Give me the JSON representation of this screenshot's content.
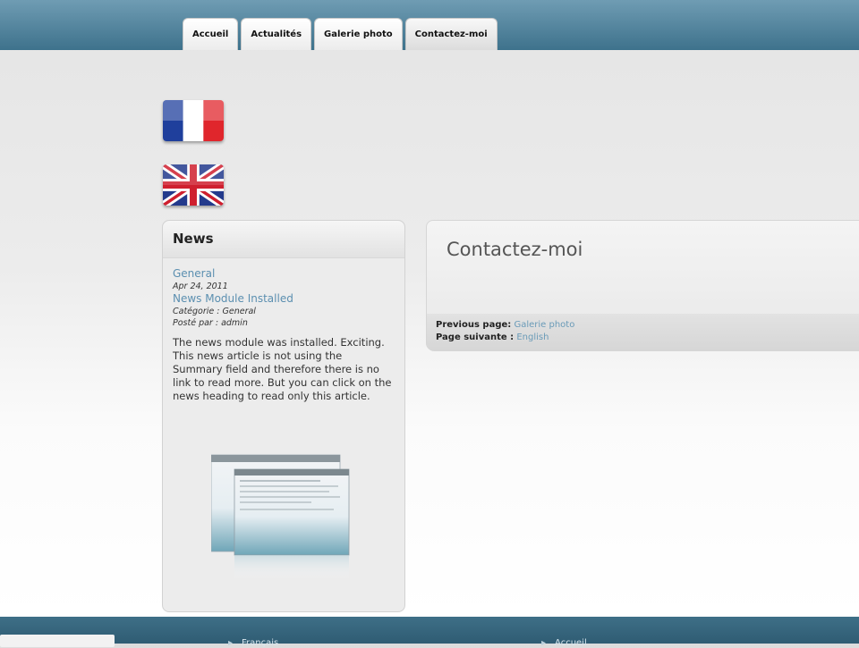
{
  "nav": {
    "tabs": [
      {
        "label": "Accueil"
      },
      {
        "label": "Actualités"
      },
      {
        "label": "Galerie photo"
      },
      {
        "label": "Contactez-moi"
      }
    ]
  },
  "languages": [
    {
      "name": "Français",
      "icon": "flag-france-icon"
    },
    {
      "name": "English",
      "icon": "flag-uk-icon"
    }
  ],
  "sidebar": {
    "title": "News",
    "news": {
      "category_link": "General",
      "date": "Apr 24, 2011",
      "headline": "News Module Installed",
      "category_line": "Catégorie : General",
      "posted_line": "Posté par : admin",
      "body": "The news module was installed. Exciting. This news article is not using the Summary field and therefore there is no link to read more. But you can click on the news heading to read only this article."
    }
  },
  "main": {
    "title": "Contactez-moi",
    "previous_label": "Previous page:",
    "previous_link": "Galerie photo",
    "next_label": "Page suivante :",
    "next_link": "English"
  },
  "footer": {
    "links": [
      "Français",
      "Accueil"
    ]
  },
  "colors": {
    "header": "#4a7f99",
    "link": "#5b8fb0",
    "footer": "#356580"
  }
}
